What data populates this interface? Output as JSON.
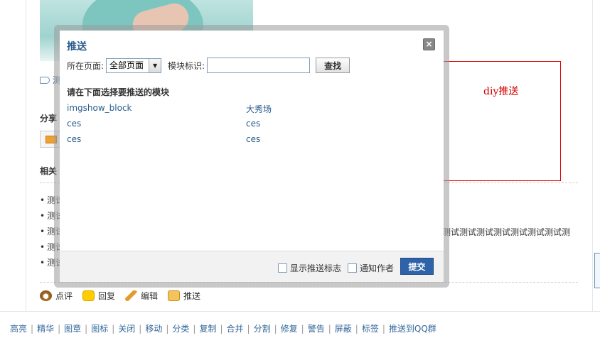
{
  "page": {
    "tag_fragment": "测",
    "share_heading": "分享",
    "related_heading": "相关",
    "related_items": [
      "测试",
      "测试",
      "测试",
      "测试",
      "测试"
    ],
    "related_long_tail": "测试测试测试测试测试测试测试测",
    "actions": {
      "comment": "点评",
      "reply": "回复",
      "edit": "编辑",
      "push": "推送"
    },
    "mod_links": [
      "高亮",
      "精华",
      "图章",
      "图标",
      "关闭",
      "移动",
      "分类",
      "复制",
      "合并",
      "分割",
      "修复",
      "警告",
      "屏蔽",
      "标签",
      "推送到QQ群"
    ]
  },
  "annotation": {
    "label": "diy推送",
    "color": "#d00000"
  },
  "dialog": {
    "title": "推送",
    "close_glyph": "×",
    "page_label": "所在页面:",
    "page_select_value": "全部页面",
    "block_id_label": "模块标识:",
    "block_id_value": "",
    "find_button": "查找",
    "choose_heading": "请在下面选择要推送的模块",
    "blocks_left": [
      "imgshow_block",
      "ces",
      "ces"
    ],
    "blocks_right": [
      "大秀场",
      "ces",
      "ces"
    ],
    "show_push_flag_label": "显示推送标志",
    "notify_author_label": "通知作者",
    "submit_button": "提交",
    "accent": "#2f63a9"
  }
}
